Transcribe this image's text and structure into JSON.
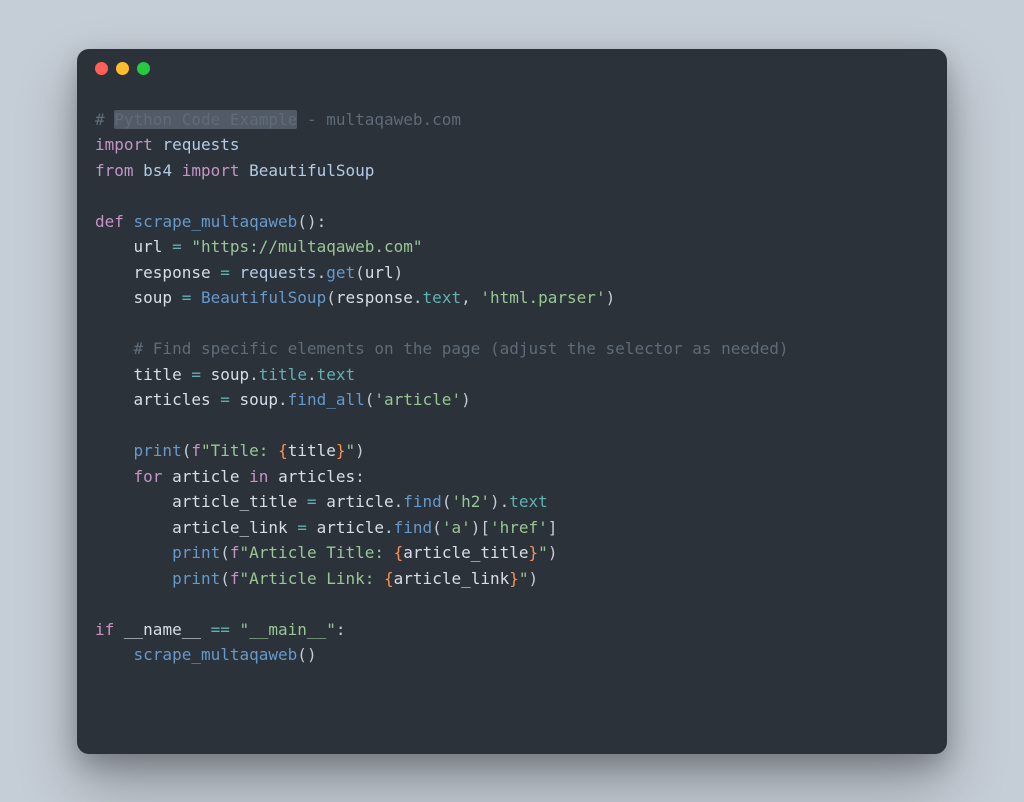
{
  "window": {
    "traffic": {
      "close": "close",
      "min": "minimize",
      "max": "maximize"
    }
  },
  "code": {
    "comment1_hash": "# ",
    "comment1_sel": "Python Code Example",
    "comment1_rest": " - multaqaweb.com",
    "kw_import": "import",
    "mod_requests": "requests",
    "kw_from": "from",
    "mod_bs4": "bs4",
    "mod_BeautifulSoup": "BeautifulSoup",
    "kw_def": "def",
    "fn_scrape": "scrape_multaqaweb",
    "lp": "(",
    "rp": ")",
    "colon": ":",
    "indent1": "    ",
    "indent2": "        ",
    "var_url": "url",
    "eq": " = ",
    "str_url": "\"https://multaqaweb.com\"",
    "var_response": "response",
    "dot": ".",
    "fn_get": "get",
    "var_soup": "soup",
    "fn_Beautiful": "BeautifulSoup",
    "attr_text": "text",
    "comma_sp": ", ",
    "str_parser": "'html.parser'",
    "comment2": "# Find specific elements on the page (adjust the selector as needed)",
    "var_title": "title",
    "attr_title": "title",
    "var_articles": "articles",
    "fn_findall": "find_all",
    "str_article": "'article'",
    "fn_print": "print",
    "f_prefix": "f",
    "dq": "\"",
    "str_title_lbl": "Title: ",
    "lb": "{",
    "rb": "}",
    "kw_for": "for",
    "var_article": "article",
    "kw_in": "in",
    "var_article_title": "article_title",
    "fn_find": "find",
    "str_h2": "'h2'",
    "var_article_link": "article_link",
    "str_a": "'a'",
    "lbr": "[",
    "rbr": "]",
    "str_href": "'href'",
    "str_art_title_lbl": "Article Title: ",
    "str_art_link_lbl": "Article Link: ",
    "kw_if": "if",
    "dunder_name": "__name__",
    "eqeq": " == ",
    "str_main": "\"__main__\""
  }
}
